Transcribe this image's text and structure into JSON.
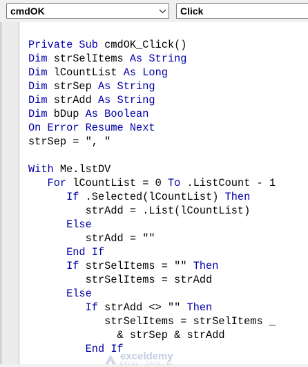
{
  "toolbar": {
    "object_combo": {
      "value": "cmdOK",
      "icon": "chevron-down-icon"
    },
    "procedure_combo": {
      "value": "Click"
    }
  },
  "code_lines": [
    [
      [
        "kw",
        "Private Sub "
      ],
      [
        "pl",
        "cmdOK_Click()"
      ]
    ],
    [
      [
        "kw",
        "Dim "
      ],
      [
        "pl",
        "strSelItems "
      ],
      [
        "kw",
        "As String"
      ]
    ],
    [
      [
        "kw",
        "Dim "
      ],
      [
        "pl",
        "lCountList "
      ],
      [
        "kw",
        "As Long"
      ]
    ],
    [
      [
        "kw",
        "Dim "
      ],
      [
        "pl",
        "strSep "
      ],
      [
        "kw",
        "As String"
      ]
    ],
    [
      [
        "kw",
        "Dim "
      ],
      [
        "pl",
        "strAdd "
      ],
      [
        "kw",
        "As String"
      ]
    ],
    [
      [
        "kw",
        "Dim "
      ],
      [
        "pl",
        "bDup "
      ],
      [
        "kw",
        "As Boolean"
      ]
    ],
    [
      [
        "kw",
        "On Error Resume Next"
      ]
    ],
    [
      [
        "pl",
        "strSep = \", \""
      ]
    ],
    [],
    [
      [
        "kw",
        "With "
      ],
      [
        "pl",
        "Me.lstDV"
      ]
    ],
    [
      [
        "pl",
        "   "
      ],
      [
        "kw",
        "For "
      ],
      [
        "pl",
        "lCountList = 0 "
      ],
      [
        "kw",
        "To "
      ],
      [
        "pl",
        ".ListCount - 1"
      ]
    ],
    [
      [
        "pl",
        "      "
      ],
      [
        "kw",
        "If "
      ],
      [
        "pl",
        ".Selected(lCountList) "
      ],
      [
        "kw",
        "Then"
      ]
    ],
    [
      [
        "pl",
        "         strAdd = .List(lCountList)"
      ]
    ],
    [
      [
        "pl",
        "      "
      ],
      [
        "kw",
        "Else"
      ]
    ],
    [
      [
        "pl",
        "         strAdd = \"\""
      ]
    ],
    [
      [
        "pl",
        "      "
      ],
      [
        "kw",
        "End If"
      ]
    ],
    [
      [
        "pl",
        "      "
      ],
      [
        "kw",
        "If "
      ],
      [
        "pl",
        "strSelItems = \"\" "
      ],
      [
        "kw",
        "Then"
      ]
    ],
    [
      [
        "pl",
        "         strSelItems = strAdd"
      ]
    ],
    [
      [
        "pl",
        "      "
      ],
      [
        "kw",
        "Else"
      ]
    ],
    [
      [
        "pl",
        "         "
      ],
      [
        "kw",
        "If "
      ],
      [
        "pl",
        "strAdd <> \"\" "
      ],
      [
        "kw",
        "Then"
      ]
    ],
    [
      [
        "pl",
        "            strSelItems = strSelItems _"
      ]
    ],
    [
      [
        "pl",
        "              & strSep & strAdd"
      ]
    ],
    [
      [
        "pl",
        "         "
      ],
      [
        "kw",
        "End If"
      ]
    ]
  ],
  "watermark": {
    "name": "exceldemy",
    "tagline": "EXCEL · DATA · BI"
  },
  "colors": {
    "keyword": "#0000a8",
    "plain": "#000000",
    "editor_bg": "#ffffff",
    "chrome_bg": "#f0f0f0"
  }
}
